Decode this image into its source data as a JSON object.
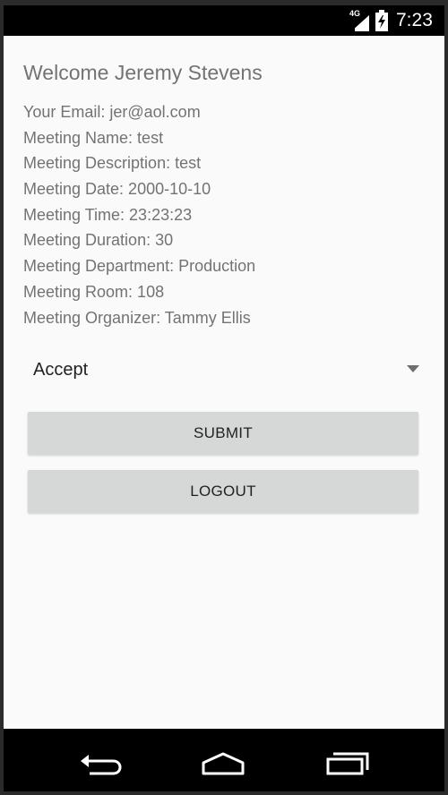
{
  "status_bar": {
    "network_label": "4G",
    "time": "7:23"
  },
  "main": {
    "welcome": "Welcome Jeremy Stevens",
    "details": [
      "Your Email: jer@aol.com",
      "Meeting Name: test",
      "Meeting Description: test",
      "Meeting Date: 2000-10-10",
      "Meeting Time: 23:23:23",
      "Meeting Duration: 30",
      "Meeting Department: Production",
      "Meeting Room: 108",
      "Meeting Organizer: Tammy Ellis"
    ],
    "response_select": {
      "selected": "Accept",
      "icon": "dropdown-arrow-icon"
    },
    "submit_label": "SUBMIT",
    "logout_label": "LOGOUT"
  },
  "nav_bar": {
    "back_icon": "back-icon",
    "home_icon": "home-icon",
    "recent_icon": "recent-apps-icon"
  },
  "colors": {
    "status_bar": "#000000",
    "background": "#fafafa",
    "text_secondary": "#737373",
    "button_bg": "#d6d7d7",
    "nav_bar": "#000000"
  }
}
